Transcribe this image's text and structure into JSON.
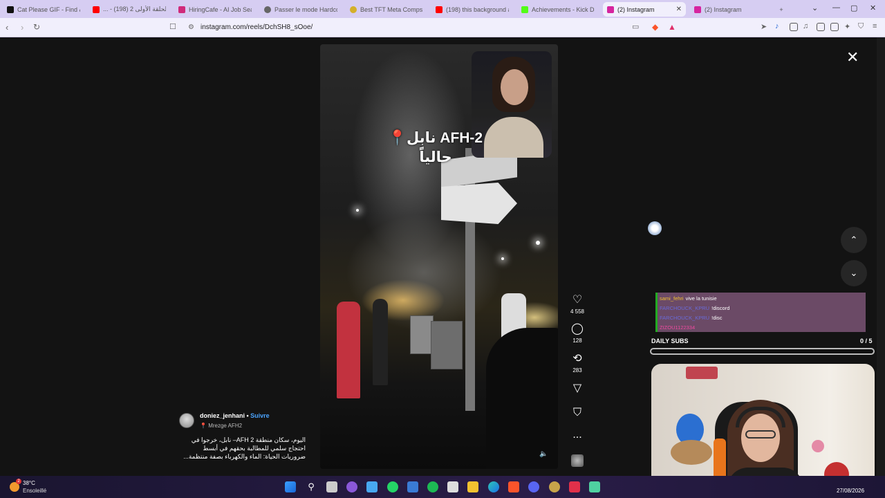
{
  "browser": {
    "tabs": [
      {
        "label": "Cat Please GIF - Find &",
        "favicon_color": "#111111"
      },
      {
        "label": "... - (198) 2 الحلقة الأولى",
        "favicon_color": "#ff0000"
      },
      {
        "label": "HiringCafe - AI Job Sear",
        "favicon_color": "#d02a7a"
      },
      {
        "label": "Passer le mode Hardcore",
        "favicon_color": "#666666"
      },
      {
        "label": "Best TFT Meta Comps &",
        "favicon_color": "#d4b02a"
      },
      {
        "label": "(198) this background ai",
        "favicon_color": "#ff0000"
      },
      {
        "label": "Achievements - Kick Das",
        "favicon_color": "#53fc18"
      },
      {
        "label": "(2) Instagram",
        "favicon_color": "#d6249f",
        "active": true
      },
      {
        "label": "(2) Instagram",
        "favicon_color": "#d6249f"
      }
    ],
    "new_tab_label": "+",
    "url": "instagram.com/reels/DchSH8_sOoe/"
  },
  "reel": {
    "overlay_line1": "نابل AFH-2",
    "overlay_line2": "حالياً",
    "author": "doniez_jenhani",
    "separator": " • ",
    "follow_label": "Suivre",
    "location": "Mrezge AFH2",
    "caption": "اليوم، سكان منطقة AFH 2– نابل، خرجوا في احتجاج سلمي للمطالبة بحقهم في أبسط ضروريات الحياة: الماء والكهرباء بصفة منتظمة...",
    "likes": "4 558",
    "comments": "128",
    "reposts": "283",
    "more_label": "..."
  },
  "stream_overlay": {
    "chat": [
      {
        "name": "sami_fehri",
        "message": "vive la tunisie",
        "name_color": "#f2c230"
      },
      {
        "name": "FARCHOUCK_KPRU",
        "message": "!discord",
        "name_color": "#6a6ad8"
      },
      {
        "name": "FARCHOUCK_KPRU",
        "message": "!disc",
        "name_color": "#6a6ad8"
      },
      {
        "name": "ZIZOU1122334",
        "message": "",
        "name_color": "#f04aa0"
      }
    ],
    "subs_label": "DAILY SUBS",
    "subs_count": "0 / 5",
    "subs_progress": 0
  },
  "taskbar": {
    "temperature": "38°C",
    "weather": "Ensoleillé",
    "weather_badge": "2",
    "date": "27/08/2026"
  }
}
